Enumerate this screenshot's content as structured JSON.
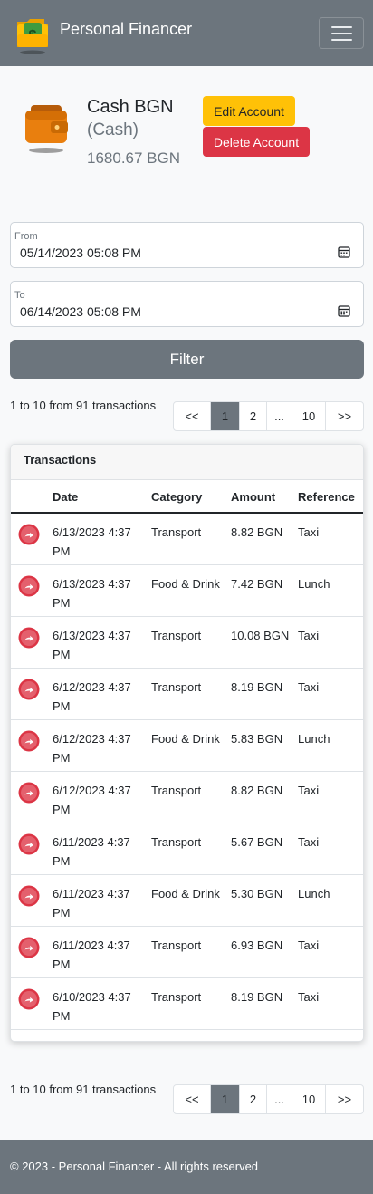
{
  "navbar": {
    "brand": "Personal Financer",
    "logo_icon": "wallet-dollar-icon",
    "menu_icon": "hamburger-icon"
  },
  "account": {
    "name": "Cash BGN",
    "type": "(Cash)",
    "balance": "1680.67 BGN",
    "edit_label": "Edit Account",
    "delete_label": "Delete Account"
  },
  "filter": {
    "from_label": "From",
    "from_value": "05/14/2023 05:08  PM",
    "to_label": "To",
    "to_value": "06/14/2023 05:08  PM",
    "button_label": "Filter"
  },
  "pagination": {
    "summary": "1 to 10 from 91 transactions",
    "pages": [
      "<<",
      "1",
      "2",
      "...",
      "10",
      ">>"
    ],
    "active": "1"
  },
  "transactions": {
    "title": "Transactions",
    "columns": [
      "Date",
      "Category",
      "Amount",
      "Reference"
    ],
    "rows": [
      {
        "date": "6/13/2023 4:37 PM",
        "category": "Transport",
        "amount": "8.82 BGN",
        "reference": "Taxi"
      },
      {
        "date": "6/13/2023 4:37 PM",
        "category": "Food & Drink",
        "amount": "7.42 BGN",
        "reference": "Lunch"
      },
      {
        "date": "6/13/2023 4:37 PM",
        "category": "Transport",
        "amount": "10.08 BGN",
        "reference": "Taxi"
      },
      {
        "date": "6/12/2023 4:37 PM",
        "category": "Transport",
        "amount": "8.19 BGN",
        "reference": "Taxi"
      },
      {
        "date": "6/12/2023 4:37 PM",
        "category": "Food & Drink",
        "amount": "5.83 BGN",
        "reference": "Lunch"
      },
      {
        "date": "6/12/2023 4:37 PM",
        "category": "Transport",
        "amount": "8.82 BGN",
        "reference": "Taxi"
      },
      {
        "date": "6/11/2023 4:37 PM",
        "category": "Transport",
        "amount": "5.67 BGN",
        "reference": "Taxi"
      },
      {
        "date": "6/11/2023 4:37 PM",
        "category": "Food & Drink",
        "amount": "5.30 BGN",
        "reference": "Lunch"
      },
      {
        "date": "6/11/2023 4:37 PM",
        "category": "Transport",
        "amount": "6.93 BGN",
        "reference": "Taxi"
      },
      {
        "date": "6/10/2023 4:37 PM",
        "category": "Transport",
        "amount": "8.19 BGN",
        "reference": "Taxi"
      }
    ]
  },
  "footer": {
    "text": "© 2023 - Personal Financer - All rights reserved"
  },
  "colors": {
    "navbar": "#6c757d",
    "warning": "#ffc107",
    "danger": "#dc3545",
    "expense_icon": "#dc3545"
  }
}
